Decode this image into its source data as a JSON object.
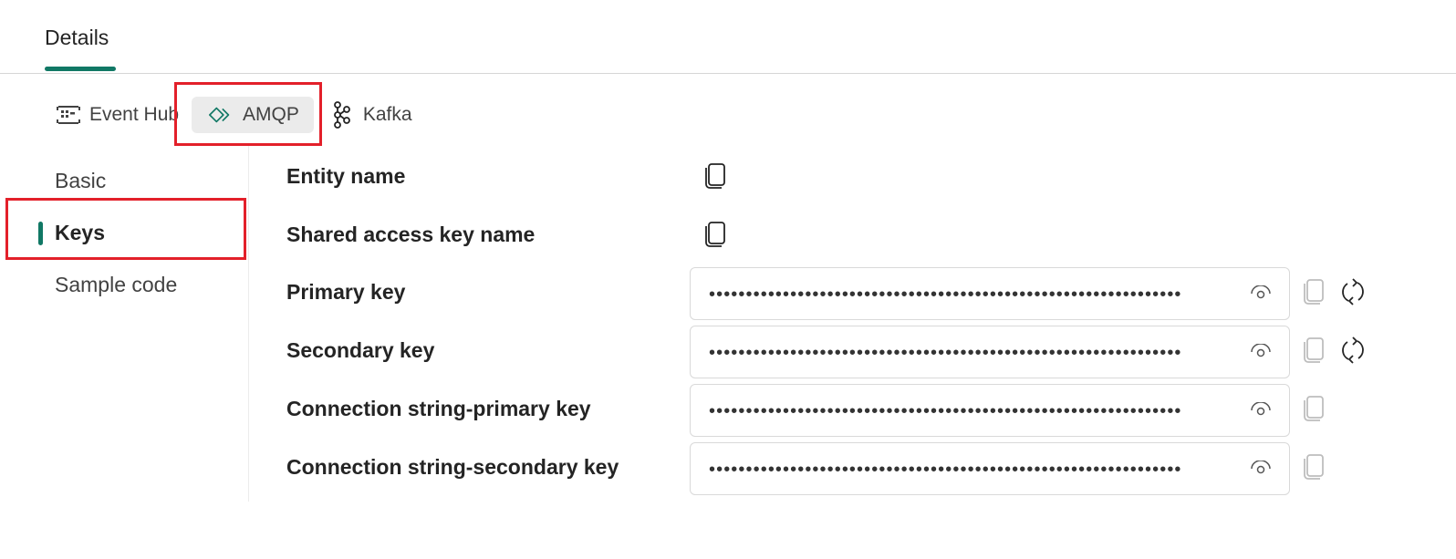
{
  "header": {
    "tab_label": "Details",
    "accent_color": "#117865"
  },
  "protocol_tabs": [
    {
      "label": "Event Hub",
      "icon": "event-hub-icon",
      "selected": false
    },
    {
      "label": "AMQP",
      "icon": "amqp-icon",
      "selected": true
    },
    {
      "label": "Kafka",
      "icon": "kafka-icon",
      "selected": false
    }
  ],
  "side_nav": {
    "items": [
      {
        "label": "Basic",
        "selected": false
      },
      {
        "label": "Keys",
        "selected": true
      },
      {
        "label": "Sample code",
        "selected": false
      }
    ]
  },
  "fields": [
    {
      "label": "Entity name",
      "type": "copy-only"
    },
    {
      "label": "Shared access key name",
      "type": "copy-only"
    },
    {
      "label": "Primary key",
      "type": "secret",
      "value": "••••••••••••••••••••••••••••••••••••••••••••••••••••••••••••••••",
      "regenerate": true
    },
    {
      "label": "Secondary key",
      "type": "secret",
      "value": "••••••••••••••••••••••••••••••••••••••••••••••••••••••••••••••••",
      "regenerate": true
    },
    {
      "label": "Connection string-primary key",
      "type": "secret",
      "value": "••••••••••••••••••••••••••••••••••••••••••••••••••••••••••••••••",
      "regenerate": false
    },
    {
      "label": "Connection string-secondary key",
      "type": "secret",
      "value": "••••••••••••••••••••••••••••••••••••••••••••••••••••••••••••••••",
      "regenerate": false
    }
  ],
  "annotation_color": "#e3202a"
}
